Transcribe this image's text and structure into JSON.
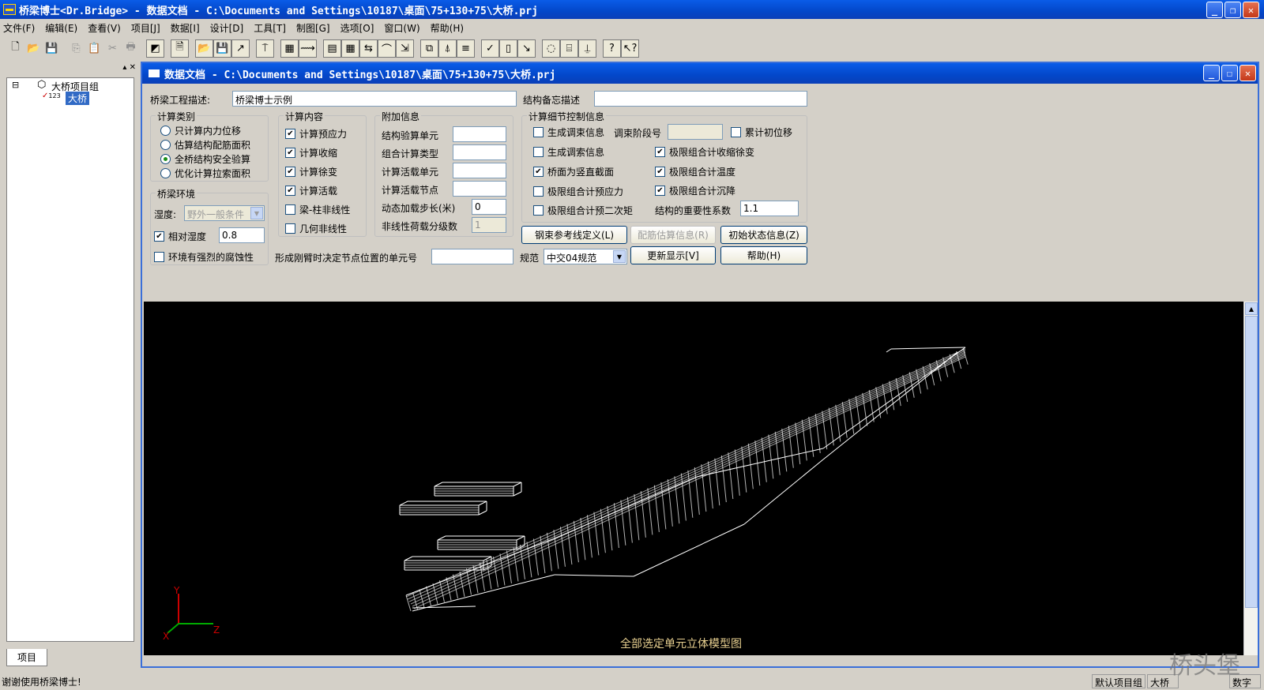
{
  "app": {
    "title": "桥梁博士<Dr.Bridge> - 数据文档 - C:\\Documents and Settings\\10187\\桌面\\75+130+75\\大桥.prj"
  },
  "menu": [
    "文件(F)",
    "编辑(E)",
    "查看(V)",
    "项目[J]",
    "数据[I]",
    "设计[D]",
    "工具[T]",
    "制图[G]",
    "选项[O]",
    "窗口(W)",
    "帮助(H)"
  ],
  "toolbar": {
    "icons": [
      {
        "name": "new-icon",
        "glyph": "🗋",
        "dim": false
      },
      {
        "name": "open-icon",
        "glyph": "📂",
        "dim": false
      },
      {
        "name": "save-icon",
        "glyph": "💾",
        "dim": false
      },
      {
        "name": "copy-icon",
        "glyph": "⎘",
        "dim": true
      },
      {
        "name": "paste-icon",
        "glyph": "📋",
        "dim": true
      },
      {
        "name": "cut-icon",
        "glyph": "✂",
        "dim": true
      },
      {
        "name": "print-icon",
        "glyph": "🖶",
        "dim": true
      },
      {
        "name": "bridge-view-icon",
        "glyph": "◩",
        "dim": false
      },
      {
        "name": "doc-icon",
        "glyph": "🗎",
        "dim": false
      },
      {
        "name": "folder-open-icon",
        "glyph": "📂",
        "dim": false
      },
      {
        "name": "disk-icon",
        "glyph": "💾",
        "dim": false
      },
      {
        "name": "curve-edit-icon",
        "glyph": "↗",
        "dim": false
      },
      {
        "name": "structure-icon",
        "glyph": "⍑",
        "dim": false
      },
      {
        "name": "grid-small-icon",
        "glyph": "▦",
        "dim": false
      },
      {
        "name": "beam-icon",
        "glyph": "⟿",
        "dim": false
      },
      {
        "name": "section-icon",
        "glyph": "▤",
        "dim": false
      },
      {
        "name": "table-icon",
        "glyph": "▦",
        "dim": false
      },
      {
        "name": "tendon-icon",
        "glyph": "⇆",
        "dim": false
      },
      {
        "name": "arc-icon",
        "glyph": "⌒",
        "dim": false
      },
      {
        "name": "load-icon",
        "glyph": "⇲",
        "dim": false
      },
      {
        "name": "truss-icon",
        "glyph": "⧉",
        "dim": false
      },
      {
        "name": "tower-icon",
        "glyph": "⍋",
        "dim": false
      },
      {
        "name": "lines-icon",
        "glyph": "≡",
        "dim": false
      },
      {
        "name": "check-edit-icon",
        "glyph": "✓",
        "dim": false
      },
      {
        "name": "page-icon",
        "glyph": "▯",
        "dim": false
      },
      {
        "name": "pointer-icon",
        "glyph": "↘",
        "dim": false
      },
      {
        "name": "circle-dots-icon",
        "glyph": "◌",
        "dim": false
      },
      {
        "name": "rebar-icon",
        "glyph": "⌸",
        "dim": false
      },
      {
        "name": "pier-icon",
        "glyph": "⍊",
        "dim": false
      },
      {
        "name": "help-icon",
        "glyph": "?",
        "dim": false
      },
      {
        "name": "context-help-icon",
        "glyph": "↖?",
        "dim": false
      }
    ]
  },
  "tree": {
    "root": "大桥项目组",
    "child": "大桥",
    "child_badge": "123",
    "tab": "项目"
  },
  "doc": {
    "title": "数据文档 - C:\\Documents and Settings\\10187\\桌面\\75+130+75\\大桥.prj",
    "project_desc_label": "桥梁工程描述:",
    "project_desc_value": "桥梁博士示例",
    "memo_label": "结构备忘描述",
    "memo_value": ""
  },
  "calc_type": {
    "title": "计算类别",
    "options": [
      "只计算内力位移",
      "估算结构配筋面积",
      "全桥结构安全验算",
      "优化计算拉索面积"
    ],
    "selected_index": 2
  },
  "environment": {
    "title": "桥梁环境",
    "humidity_label": "湿度:",
    "humidity_value": "野外一般条件",
    "relative_humidity_label": "相对湿度",
    "relative_humidity_value": "0.8",
    "corrosion_label": "环境有强烈的腐蚀性"
  },
  "calc_content": {
    "title": "计算内容",
    "items": [
      {
        "label": "计算预应力",
        "checked": true
      },
      {
        "label": "计算收缩",
        "checked": true
      },
      {
        "label": "计算徐变",
        "checked": true
      },
      {
        "label": "计算活载",
        "checked": true
      },
      {
        "label": "梁-柱非线性",
        "checked": false
      },
      {
        "label": "几何非线性",
        "checked": false
      }
    ]
  },
  "extra_info": {
    "title": "附加信息",
    "fields": [
      {
        "label": "结构验算单元",
        "value": ""
      },
      {
        "label": "组合计算类型",
        "value": ""
      },
      {
        "label": "计算活载单元",
        "value": ""
      },
      {
        "label": "计算活载节点",
        "value": ""
      },
      {
        "label": "动态加载步长(米)",
        "value": "0"
      },
      {
        "label": "非线性荷载分级数",
        "value": "1"
      }
    ]
  },
  "detail_control": {
    "title": "计算细节控制信息",
    "gen_tendon_info": "生成调束信息",
    "tendon_stage_label": "调束阶段号",
    "tendon_stage_value": "",
    "accum_disp": "累计初位移",
    "gen_cable_info": "生成调索信息",
    "limit_shrink": "极限组合计收缩徐变",
    "deck_vertical": "桥面为竖直截面",
    "limit_temp": "极限组合计温度",
    "limit_prestress": "极限组合计预应力",
    "limit_settle": "极限组合计沉降",
    "limit_secondary": "极限组合计预二次矩",
    "importance_label": "结构的重要性系数",
    "importance_value": "1.1"
  },
  "buttons": {
    "tendon_ref": "钢束参考线定义(L)",
    "rebar_estimate": "配筋估算信息(R)",
    "initial_state": "初始状态信息(Z)",
    "refresh": "更新显示[V]",
    "help": "帮助(H)"
  },
  "bottom_row": {
    "cantilever_label": "形成刚臂时决定节点位置的单元号",
    "cantilever_value": "",
    "code_label": "规范",
    "code_value": "中交04规范"
  },
  "viewer": {
    "caption": "全部选定单元立体模型图",
    "axis_y": "Y",
    "axis_x": "X",
    "axis_z": "Z"
  },
  "status": {
    "message": "谢谢使用桥梁博士!",
    "panel_group": "默认项目组",
    "panel_bridge": "大桥",
    "panel_num": "数字"
  },
  "watermark": "桥头堡"
}
